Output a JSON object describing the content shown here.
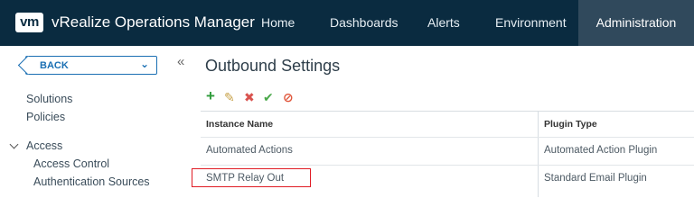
{
  "header": {
    "logo": "vm",
    "app_title": "vRealize Operations Manager",
    "nav": [
      "Home",
      "Dashboards",
      "Alerts",
      "Environment",
      "Administration"
    ],
    "active_nav": "Administration"
  },
  "sidebar": {
    "back_label": "BACK",
    "collapse_glyph": "«",
    "links": [
      "Solutions",
      "Policies"
    ],
    "group": {
      "label": "Access",
      "items": [
        "Access Control",
        "Authentication Sources"
      ]
    }
  },
  "main": {
    "title": "Outbound Settings",
    "toolbar": [
      "add-icon",
      "edit-icon",
      "delete-icon",
      "test-icon",
      "disable-icon"
    ],
    "table": {
      "columns": [
        "Instance Name",
        "Plugin Type"
      ],
      "rows": [
        {
          "name": "Automated Actions",
          "plugin": "Automated Action Plugin"
        },
        {
          "name": "SMTP Relay Out",
          "plugin": "Standard Email Plugin"
        }
      ]
    }
  },
  "colors": {
    "header_bg": "#0a2b40",
    "active_nav_bg": "#30495c",
    "accent": "#1a6fb3",
    "highlight": "#e01b24",
    "add": "#2e9b3a",
    "edit": "#c8a24a",
    "delete": "#d9534f",
    "test": "#4aa84a",
    "disable": "#e0563b"
  }
}
